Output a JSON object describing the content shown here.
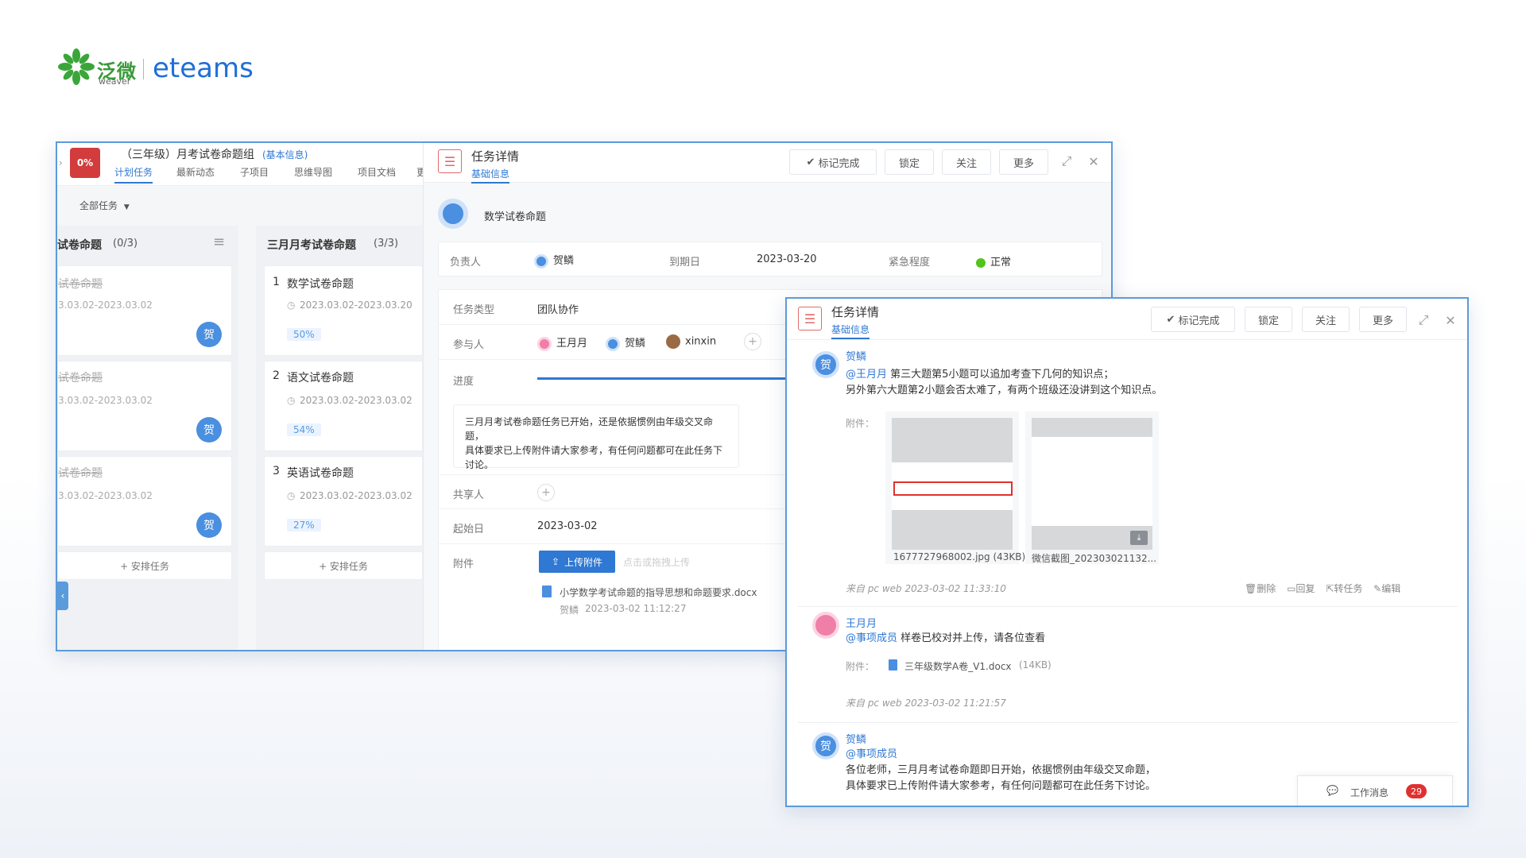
{
  "logo": {
    "cn": "泛微",
    "weaver": "weaver",
    "en": "eteams",
    "icon": "weaver-flower-icon"
  },
  "project": {
    "badge": "0%",
    "title": "（三年级）月考试卷命题组",
    "info_link": "(基本信息)",
    "tabs": [
      "计划任务",
      "最新动态",
      "子项目",
      "思维导图",
      "项目文档",
      "更"
    ],
    "filter": "全部任务",
    "col1": {
      "title": "试卷命题",
      "count": "(0/3)",
      "cards": [
        {
          "name": "试卷命题",
          "date": "3.03.02-2023.03.02",
          "avatar": "贺"
        },
        {
          "name": "试卷命题",
          "date": "3.03.02-2023.03.02",
          "avatar": "贺"
        },
        {
          "name": "试卷命题",
          "date": "3.03.02-2023.03.02",
          "avatar": "贺"
        }
      ],
      "add": "+ 安排任务"
    },
    "col2": {
      "title": "三月月考试卷命题",
      "count": "(3/3)",
      "cards": [
        {
          "num": "1",
          "name": "数学试卷命题",
          "date": "2023.03.02-2023.03.20",
          "progress": "50%"
        },
        {
          "num": "2",
          "name": "语文试卷命题",
          "date": "2023.03.02-2023.03.02",
          "progress": "54%"
        },
        {
          "num": "3",
          "name": "英语试卷命题",
          "date": "2023.03.02-2023.03.02",
          "progress": "27%"
        }
      ],
      "add": "+ 安排任务"
    }
  },
  "detail": {
    "title": "任务详情",
    "subtab": "基础信息",
    "buttons": {
      "complete": "标记完成",
      "lock": "锁定",
      "follow": "关注",
      "more": "更多"
    },
    "task_name": "数学试卷命题",
    "owner_label": "负责人",
    "owner": "贺鳞",
    "due_label": "到期日",
    "due": "2023-03-20",
    "urgency_label": "紧急程度",
    "urgency": "正常",
    "type_label": "任务类型",
    "type": "团队协作",
    "participants_label": "参与人",
    "participants": [
      "王月月",
      "贺鳞",
      "xinxin"
    ],
    "progress_label": "进度",
    "description": [
      "三月月考试卷命题任务已开始，还是依据惯例由年级交叉命题，",
      "具体要求已上传附件请大家参考，有任何问题都可在此任务下讨论。"
    ],
    "sharer_label": "共享人",
    "start_label": "起始日",
    "start": "2023-03-02",
    "attach_label": "附件",
    "upload_btn": "上传附件",
    "upload_hint": "点击或拖拽上传",
    "file": {
      "name": "小学数学考试命题的指导思想和命题要求.docx",
      "user": "贺鳞",
      "time": "2023-03-02 11:12:27"
    }
  },
  "chat": {
    "title": "任务详情",
    "subtab": "基础信息",
    "buttons": {
      "complete": "标记完成",
      "lock": "锁定",
      "follow": "关注",
      "more": "更多"
    },
    "messages": [
      {
        "avatar": "贺",
        "user": "贺鳞",
        "mention": "@王月月",
        "text1": " 第三大题第5小题可以追加考查下几何的知识点；",
        "text2": "另外第六大题第2小题会否太难了，有两个班级还没讲到这个知识点。",
        "attach_label": "附件：",
        "files": [
          "1677727968002.jpg (43KB)",
          "微信截图_202303021132..."
        ],
        "meta": "来自 pc web 2023-03-02 11:33:10",
        "actions": [
          "删除",
          "回复",
          "转任务",
          "编辑"
        ]
      },
      {
        "avatar": "",
        "user": "王月月",
        "mention": "@事项成员",
        "text1": " 样卷已校对并上传，请各位查看",
        "attach_label": "附件：",
        "file": "三年级数学A卷_V1.docx",
        "file_size": "(14KB)",
        "meta": "来自 pc web 2023-03-02 11:21:57"
      },
      {
        "avatar": "贺",
        "user": "贺鳞",
        "mention": "@事项成员",
        "text1": "各位老师，三月月考试卷命题即日开始，依据惯例由年级交叉命题，",
        "text2": "具体要求已上传附件请大家参考，有任何问题都可在此任务下讨论。"
      }
    ],
    "work_msg": "工作消息",
    "work_count": "29"
  },
  "colors": {
    "accent": "#2f78d3",
    "border": "#5a9bdc",
    "badge": "#d23c3c",
    "green": "#52c41a"
  }
}
